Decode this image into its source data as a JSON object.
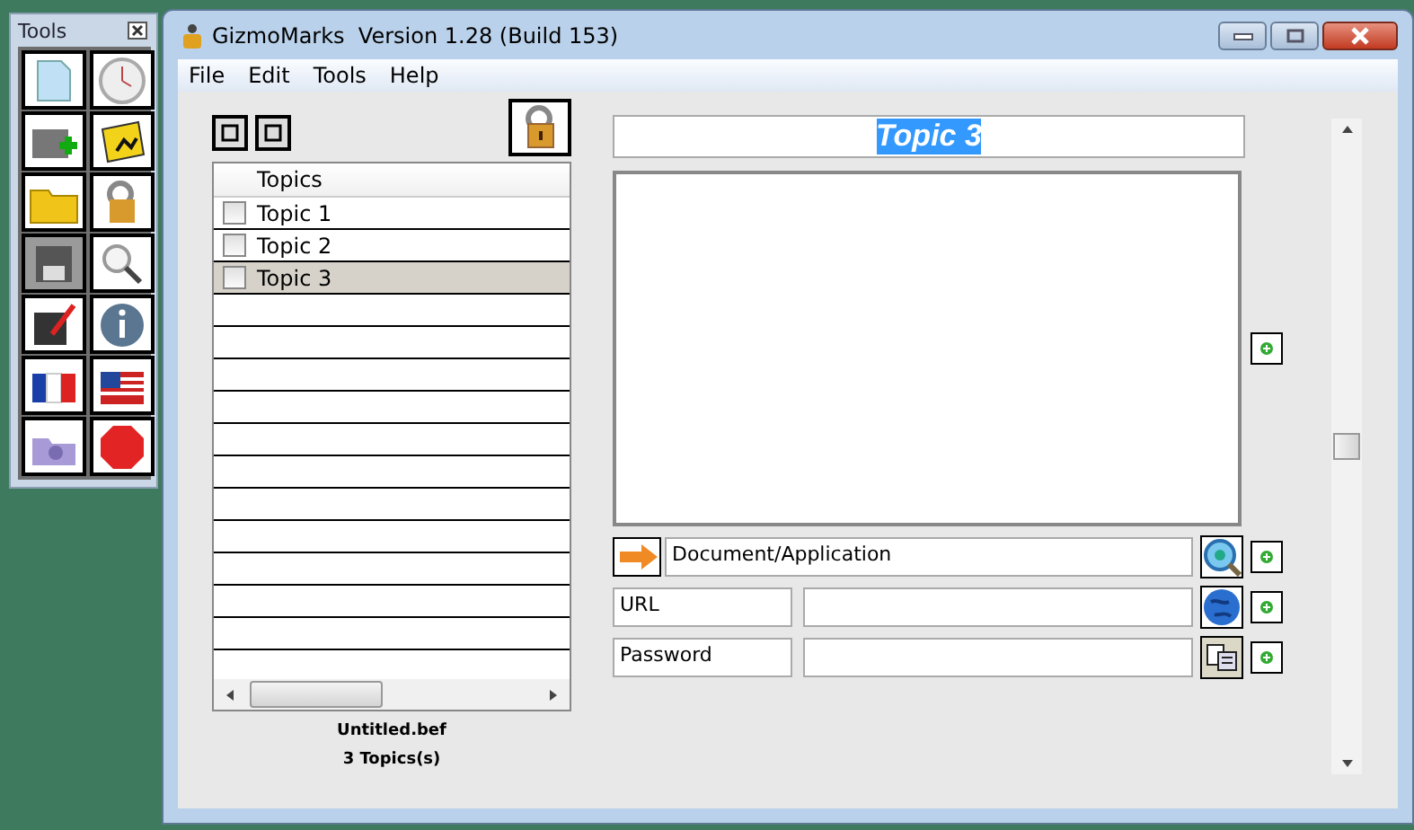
{
  "tools": {
    "title": "Tools",
    "buttons": [
      {
        "selected": false
      },
      {
        "selected": false
      },
      {
        "selected": false
      },
      {
        "selected": false
      },
      {
        "selected": false
      },
      {
        "selected": false
      },
      {
        "selected": true
      },
      {
        "selected": false
      },
      {
        "selected": false
      },
      {
        "selected": false
      },
      {
        "selected": false
      },
      {
        "selected": false
      },
      {
        "selected": false
      },
      {
        "selected": false
      }
    ]
  },
  "window": {
    "title": "GizmoMarks  Version 1.28 (Build 153)"
  },
  "menu": [
    "File",
    "Edit",
    "Tools",
    "Help"
  ],
  "topics": {
    "header": "Topics",
    "rows": [
      {
        "label": "Topic 1",
        "checked": false,
        "selected": false
      },
      {
        "label": "Topic 2",
        "checked": false,
        "selected": false
      },
      {
        "label": "Topic 3",
        "checked": false,
        "selected": true
      }
    ]
  },
  "status": {
    "file": "Untitled.bef",
    "count": "3 Topics(s)"
  },
  "title_field": {
    "value": "Topic 3",
    "text_selected": true
  },
  "links": [
    {
      "kind": "document",
      "value": "Document/Application"
    },
    {
      "kind": "url",
      "label": "URL"
    },
    {
      "kind": "password",
      "label": "Password"
    }
  ]
}
